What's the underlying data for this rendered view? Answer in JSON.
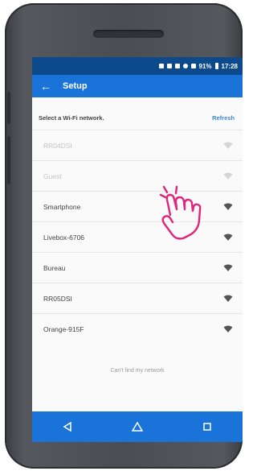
{
  "statusbar": {
    "time": "17:28",
    "battery": "91%"
  },
  "appbar": {
    "back_icon": "arrow-left-icon",
    "title": "Setup"
  },
  "wifi_section": {
    "prompt": "Select a Wi-Fi network.",
    "refresh_label": "Refresh"
  },
  "networks": [
    {
      "name": "RR04DSI",
      "state": "dim"
    },
    {
      "name": "Guest",
      "state": "dim"
    },
    {
      "name": "Smartphone",
      "state": "normal"
    },
    {
      "name": "Livebox-6706",
      "state": "normal"
    },
    {
      "name": "Bureau",
      "state": "normal"
    },
    {
      "name": "RR05DSI",
      "state": "normal"
    },
    {
      "name": "Orange-915F",
      "state": "normal"
    }
  ],
  "cant_find": "Can't find my network",
  "navbar": {
    "back": "back-triangle-icon",
    "home": "home-icon",
    "recents": "recents-square-icon"
  },
  "colors": {
    "primary": "#1a73d9",
    "statusbar": "#0c4a8c",
    "accent_pink": "#e0257a"
  }
}
